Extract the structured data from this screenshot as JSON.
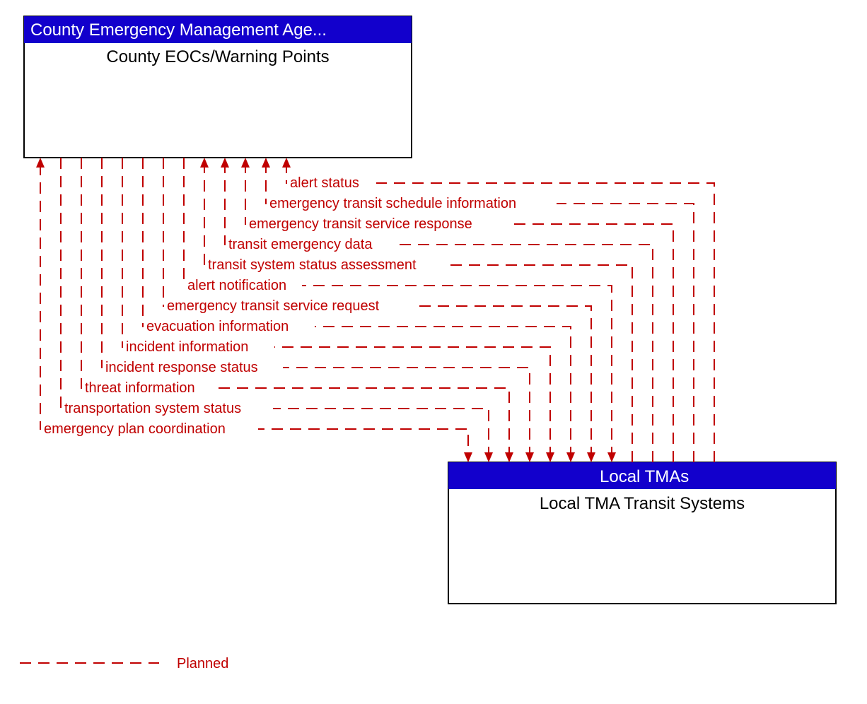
{
  "top_node": {
    "header": "County Emergency Management Age...",
    "body": "County EOCs/Warning Points"
  },
  "bottom_node": {
    "header": "Local TMAs",
    "body": "Local TMA Transit Systems"
  },
  "flows": [
    {
      "label": "alert status",
      "direction": "up"
    },
    {
      "label": "emergency transit schedule information",
      "direction": "up"
    },
    {
      "label": "emergency transit service response",
      "direction": "up"
    },
    {
      "label": "transit emergency data",
      "direction": "up"
    },
    {
      "label": "transit system status assessment",
      "direction": "up"
    },
    {
      "label": "alert notification",
      "direction": "down"
    },
    {
      "label": "emergency transit service request",
      "direction": "down"
    },
    {
      "label": "evacuation information",
      "direction": "down"
    },
    {
      "label": "incident information",
      "direction": "down"
    },
    {
      "label": "incident response status",
      "direction": "down"
    },
    {
      "label": "threat information",
      "direction": "down"
    },
    {
      "label": "transportation system status",
      "direction": "down"
    },
    {
      "label": "emergency plan coordination",
      "direction": "both"
    }
  ],
  "legend": {
    "label": "Planned"
  },
  "colors": {
    "header_fill": "#1200cc",
    "flow_color": "#c00000"
  }
}
